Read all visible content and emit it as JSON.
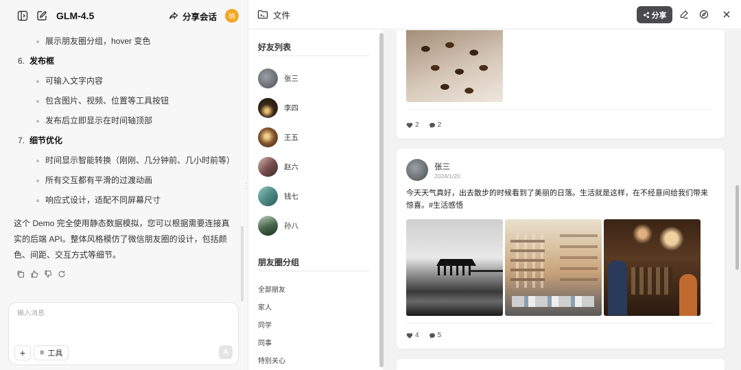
{
  "chat": {
    "model_name": "GLM-4.5",
    "share_label": "分享会话",
    "user_avatar_text": "明",
    "items": [
      {
        "kind": "bullet",
        "text": "展示朋友圈分组，hover 变色"
      },
      {
        "kind": "num",
        "num": "6.",
        "text": "发布框"
      },
      {
        "kind": "bullet",
        "text": "可输入文字内容"
      },
      {
        "kind": "bullet",
        "text": "包含图片、视频、位置等工具按钮"
      },
      {
        "kind": "bullet",
        "text": "发布后立即显示在时间轴顶部"
      },
      {
        "kind": "num",
        "num": "7.",
        "text": "细节优化"
      },
      {
        "kind": "bullet",
        "text": "时间显示智能转换（刚刚、几分钟前、几小时前等）"
      },
      {
        "kind": "bullet",
        "text": "所有交互都有平滑的过渡动画"
      },
      {
        "kind": "bullet",
        "text": "响应式设计，适配不同屏幕尺寸"
      }
    ],
    "summary": "这个 Demo 完全使用静态数据模拟，您可以根据需要连接真实的后端 API。整体风格模仿了微信朋友圈的设计，包括颜色、间距、交互方式等细节。",
    "composer_placeholder": "输入消息",
    "tools_label": "工具"
  },
  "file_panel": {
    "title": "文件",
    "share_label": "分享"
  },
  "sidebar": {
    "friends_title": "好友列表",
    "friends": [
      {
        "name": "张三",
        "color": "#6b7075"
      },
      {
        "name": "李四",
        "color": "#3a2a1a"
      },
      {
        "name": "王五",
        "color": "#8a5a30"
      },
      {
        "name": "赵六",
        "color": "#7a5050"
      },
      {
        "name": "钱七",
        "color": "#4f8a86"
      },
      {
        "name": "孙八",
        "color": "#4a6a50"
      }
    ],
    "groups_title": "朋友圈分组",
    "groups": [
      "全部朋友",
      "家人",
      "同学",
      "同事",
      "特别关心"
    ]
  },
  "posts": [
    {
      "likes": "2",
      "comments": "2"
    },
    {
      "author": "张三",
      "time": "2024/1/20",
      "text": "今天天气真好，出去散步的时候看到了美丽的日落。生活就是这样，在不经意间给我们带来惊喜。#生活感悟",
      "likes": "4",
      "comments": "5"
    }
  ]
}
